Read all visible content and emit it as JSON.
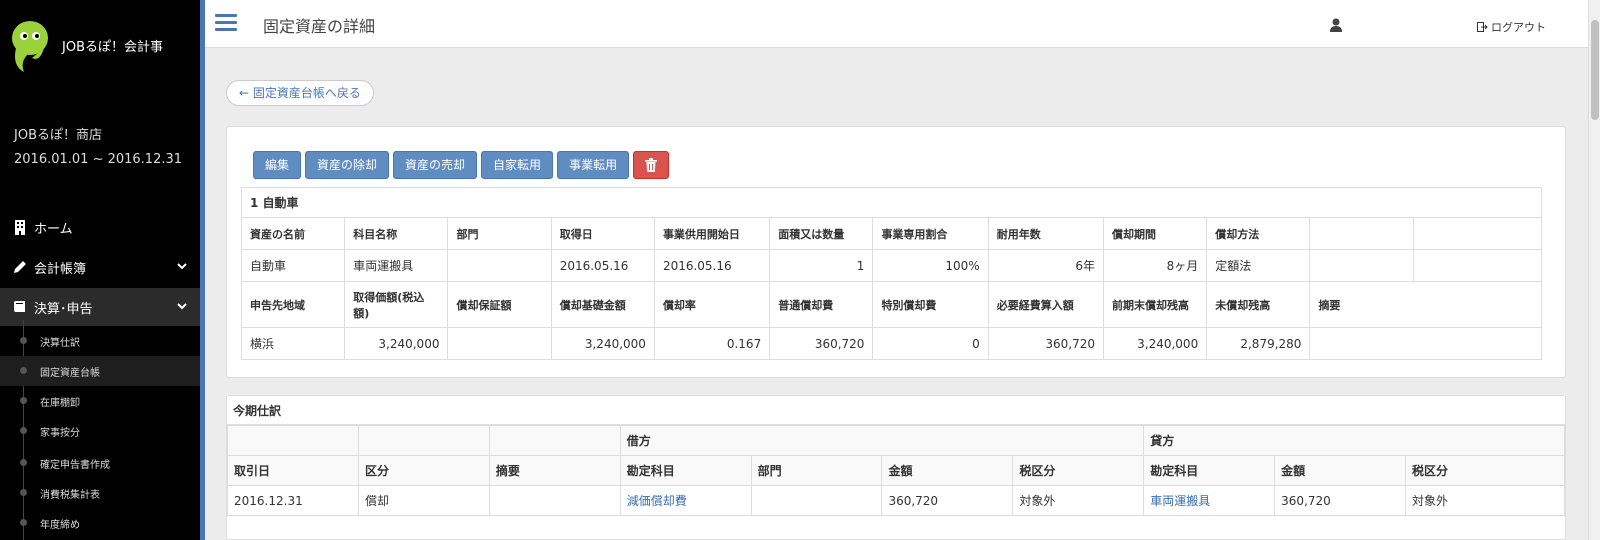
{
  "app": {
    "brand_name": "JOBるぽ！会計事",
    "company_name": "JOBるぽ！商店",
    "period": "2016.01.01 ~ 2016.12.31"
  },
  "sidebar": {
    "nav": [
      {
        "label": "ホーム",
        "icon": "building-icon"
      },
      {
        "label": "会計帳簿",
        "icon": "pencil-icon"
      },
      {
        "label": "決算･申告",
        "icon": "book-icon"
      }
    ],
    "subitems": [
      "決算仕訳",
      "固定資産台帳",
      "在庫棚卸",
      "家事按分",
      "確定申告書作成",
      "消費税集計表",
      "年度締め"
    ]
  },
  "header": {
    "title": "固定資産の詳細",
    "logout_label": "ログアウト"
  },
  "back_link": "← 固定資産台帳へ戻る",
  "actions": {
    "edit": "編集",
    "retire": "資産の除却",
    "sell": "資産の売却",
    "home_use": "自家転用",
    "business_use": "事業転用"
  },
  "asset": {
    "heading": "1 自動車",
    "headers1": [
      "資産の名前",
      "科目名称",
      "部門",
      "取得日",
      "事業供用開始日",
      "面積又は数量",
      "事業専用割合",
      "耐用年数",
      "償却期間",
      "償却方法",
      "",
      ""
    ],
    "row1": [
      "自動車",
      "車両運搬具",
      "",
      "2016.05.16",
      "2016.05.16",
      "1",
      "100%",
      "6年",
      "8ヶ月",
      "定額法",
      "",
      ""
    ],
    "headers2": [
      "申告先地域",
      "取得価額(税込額)",
      "償却保証額",
      "償却基礎金額",
      "償却率",
      "普通償却費",
      "特別償却費",
      "必要経費算入額",
      "前期末償却残高",
      "未償却残高",
      "摘要"
    ],
    "row2": [
      "横浜",
      "3,240,000",
      "",
      "3,240,000",
      "0.167",
      "360,720",
      "0",
      "360,720",
      "3,240,000",
      "2,879,280",
      ""
    ]
  },
  "journal": {
    "heading": "今期仕訳",
    "debit_label": "借方",
    "credit_label": "貸方",
    "headers": [
      "取引日",
      "区分",
      "摘要",
      "勘定科目",
      "部門",
      "金額",
      "税区分",
      "勘定科目",
      "金額",
      "税区分"
    ],
    "rows": [
      [
        "2016.12.31",
        "償却",
        "",
        "減価償却費",
        "",
        "360,720",
        "対象外",
        "車両運搬具",
        "360,720",
        "対象外"
      ]
    ]
  },
  "colors": {
    "accent": "#4a77b4",
    "button": "#5f8dc2",
    "danger": "#d9534f",
    "sidebar_bg": "#000000",
    "link": "#3a6db0"
  }
}
